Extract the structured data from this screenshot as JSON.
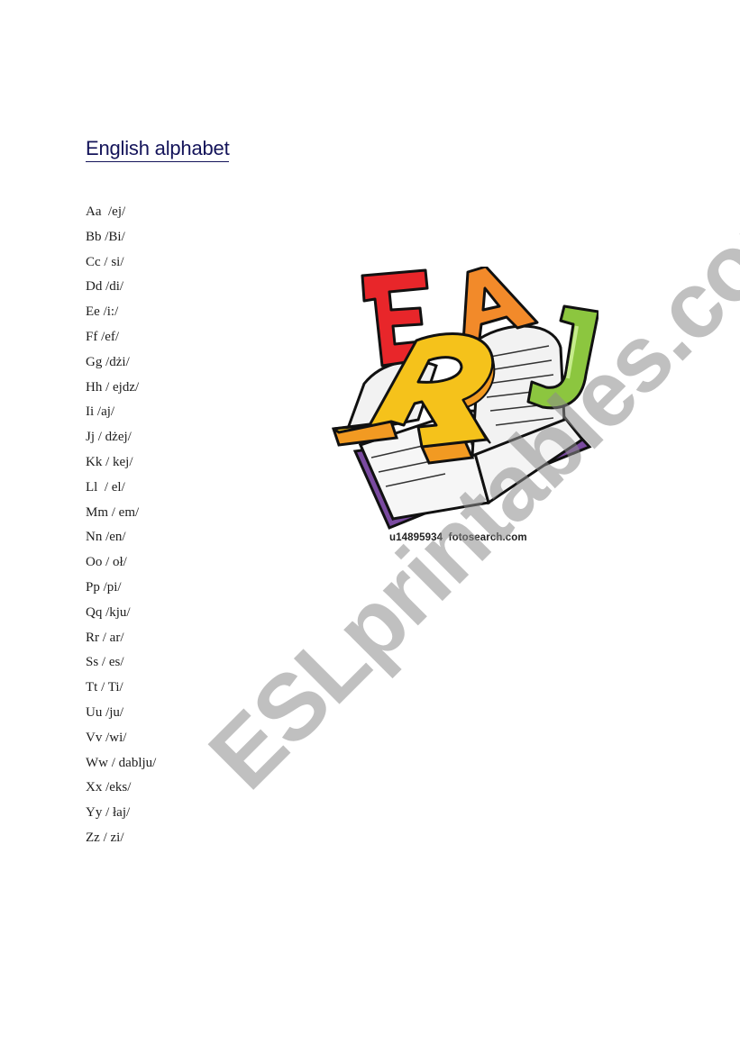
{
  "document": {
    "title": "English alphabet",
    "letters": [
      {
        "text": "Aa  /ej/"
      },
      {
        "text": "Bb /Bi/"
      },
      {
        "text": "Cc / si/"
      },
      {
        "text": "Dd /di/"
      },
      {
        "text": "Ee /i:/"
      },
      {
        "text": "Ff /ef/"
      },
      {
        "text": "Gg /dżi/"
      },
      {
        "text": "Hh / ejdz/"
      },
      {
        "text": "Ii /aj/"
      },
      {
        "text": "Jj / dżej/"
      },
      {
        "text": "Kk / kej/"
      },
      {
        "text": "Ll  / el/"
      },
      {
        "text": "Mm / em/"
      },
      {
        "text": "Nn /en/"
      },
      {
        "text": "Oo / oł/"
      },
      {
        "text": "Pp /pi/"
      },
      {
        "text": "Qq /kju/"
      },
      {
        "text": "Rr / ar/"
      },
      {
        "text": "Ss / es/"
      },
      {
        "text": "Tt / Ti/"
      },
      {
        "text": "Uu /ju/"
      },
      {
        "text": "Vv /wi/"
      },
      {
        "text": "Ww / dablju/"
      },
      {
        "text": "Xx /eks/"
      },
      {
        "text": "Yy / łaj/"
      },
      {
        "text": "Zz / zi/"
      }
    ],
    "image": {
      "description": "book-with-letters-clipart",
      "letters_shown": [
        "E",
        "A",
        "R",
        "J"
      ],
      "caption": "u14895934  fotosearch.com"
    },
    "watermark": "ESLprintables.com",
    "colors": {
      "title": "#14145a",
      "letter_e": "#e8262a",
      "letter_a": "#f28a2a",
      "letter_r": "#f5c21b",
      "letter_r_side": "#f29a22",
      "letter_j": "#8cc63f",
      "book_cover": "#7a4aa0",
      "watermark": "#8c8c8c"
    }
  }
}
